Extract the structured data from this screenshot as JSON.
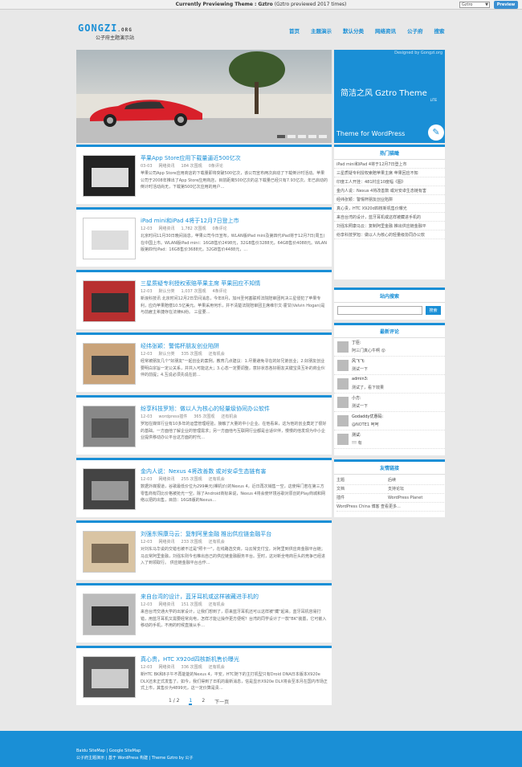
{
  "topbar": {
    "prefix": "Currently Previewing Theme :",
    "theme": "Gztro",
    "times": "(Gztro previewed 2017 times)",
    "select": "Gztro",
    "preview": "Preview"
  },
  "logo": {
    "main": "GONGZI",
    "tld": ".ORG",
    "sub": "公子府主题演示站"
  },
  "nav": [
    "首页",
    "主题演示",
    "默认分类",
    "网络资讯",
    "公子府",
    "搜索"
  ],
  "slider": {
    "credit": "Designed by Gongzi.org",
    "title": "简洁之风 Gztro Theme",
    "lite": "LITE",
    "subtitle": "Theme for WordPress",
    "pen": "✎"
  },
  "posts": [
    {
      "title": "苹果App Store应用下载量逼近500亿次",
      "date": "03-03",
      "cat": "网络资讯",
      "views": "184 次围观",
      "comments": "0条评论",
      "excerpt": "苹果公司App Store应用商店的下载量即将突破500亿次，该公司宣布两次启动了下载倒计时活动。苹果公司于2008年推出了App Store应用商店，目前距离500亿次的总下载量已经只有7.93亿次。年已启动的倒计时活动尚无，下载第500亿次应用的用户…"
    },
    {
      "title": "iPad mini和iPad 4将于12月7日登上市",
      "date": "12-03",
      "cat": "网络资讯",
      "views": "1,782 次围观",
      "comments": "0条评论",
      "excerpt": "北京时间11月30日晚间消息，苹果公司今日宣布，WLAN版iPad mini及第四代iPad将于12月7日(周五)在中国上市。WLAN版iPad mini：16GB售价2498元，32GB售价3288元，64GB售价4088元。WLAN版第四代iPad：16GB售价3688元，32GB售价4488元，…"
    },
    {
      "title": "三星质疑专利授权索赔苹果主席 苹果回应不知情",
      "date": "12-03",
      "cat": "默认分类",
      "views": "1,037 次围观",
      "comments": "4条评论",
      "excerpt": "新浪科技讯 北京时间12月2日早间消息，今年8月，加州圣何塞联邦法院陪审团判决三星侵犯了苹果专利，应向苹果赔偿10.5亿美元。苹果采用何乐，并不清楚法院陪审团主席维尔文·霍甘(Velvin Hogan)是与前雇主希捷存在法律纠纷。        三星要…"
    },
    {
      "title": "经纬张颖：警惕杯朋友创业陷阱",
      "date": "12-03",
      "cat": "默认分类",
      "views": "335 次围观",
      "comments": "还有机会",
      "excerpt": "经常被朋友几个\"好朋友\"一起创业的案例，教育几点建议：1.尽量避免寻在的好兄弟创业；2.好朋友创业要明白宗旨一定公关系，并共入可能这大；3.心态一定要调整，意好状态各好朋友关键宝贵互补的商业伙伴的前提；4.互说必须先说在前…"
    },
    {
      "title": "纷享科技罗旭：做以人为核心的轻量级协同办公软件",
      "date": "12-03",
      "cat": "wordpress插件",
      "views": "365 次围观",
      "comments": "还有机会",
      "excerpt": "罗旭在媒体行业有10多年的运营管理经验，接触了大量的中小企业。在他看来，这为他的创业奠定了很好的基础。一方面他了解企业的管理需求；另一方面他与互联网行业都是合适伙伴，慢慢的他发现为中小企业提供移动办公平台这方面的时代…"
    },
    {
      "title": "金内人说：Nexus 4将改善数 或对安卓生态链有害",
      "date": "12-03",
      "cat": "网络资讯",
      "views": "255 次围观",
      "comments": "还有机会",
      "excerpt": "数据外媒报道，谷歌最低价位为299美元(裸机价)的Nexus 4，近日再次销售一空，这使得门若在第三方零售商有同比价格被抢光一空。除了Android商标来说，Nexus 4将会使环境谷歌对原创的Play商城和网络以把的出售，目前：16GB版的Nexus…"
    },
    {
      "title": "刘强东照康马云：复制阿里金融 推出供应链金融平台",
      "date": "12-03",
      "cat": "网络资讯",
      "views": "233 次围观",
      "comments": "还有机会",
      "excerpt": "对刘东马华说的交错也被不过是\"照卡一\"，在线路选交商，马云常支付宝，对阿里到供应商金融平台链；马云常阿里金融，刘强东则今也推出自己的供应链金融服务平台。至时，这对新全电商巨头的竞争已经进入了到领取行。      供应链金融平台合作…"
    },
    {
      "title": "来自台湾的设计，蓝牙耳机或这样被藏进手机的",
      "date": "12-03",
      "cat": "网络资讯",
      "views": "151 次围观",
      "comments": "还有机会",
      "excerpt": "来自台湾交通大学的出家设计，让我们想到了，原来蓝牙耳机还可以这样被\"藏\"起来。蓝牙耳机容易打错，用蓝牙耳机又需要经常充电，怎样才能让操作更方便呢？台湾的同学设计了一款\"BK\"装置，它可嵌入移动的手机，不用的时候直接从手…"
    },
    {
      "title": "真心贵，HTC X920d四核新机售价曝光",
      "date": "12-03",
      "cat": "网络资讯",
      "views": "336 次围观",
      "comments": "还有机会",
      "excerpt": "新HTC BK和8子午不再能能的Nexus 4，平安，HTC随下的主打机型只有Droid DNA日本版本X920e DLX还未正式发售了。如今，我们得到了日机的最新消息，信是显示X920e DLX将会至本月在国内市场正式上市，其售价为4899元，这一定价算是贵…"
    }
  ],
  "pager": [
    "1 / 2",
    "1",
    "2",
    "下一页"
  ],
  "hot": {
    "title": "热门猫瞰",
    "items": [
      "iPad mini和iPad 4将于12月7日登上市",
      "三星质疑专利授权索赔苹果主席 苹果回应不知",
      "印度工人开挂：481村庄10度幅《图》",
      "金内人说：Nexus 4将改善数 或对安卓生态链有害",
      "经纬张颖：警惕杯朋友创业陷阱",
      "真心贵，HTC X920d四核新机售价曝光",
      "来自台湾的设计，蓝牙耳机或这样被藏进手机的",
      "刘强东照康马云：复制阿里金融 推出供应链金融平",
      "纷享科技罗旭：做以人为核心的轻量级协同办公软"
    ]
  },
  "searchw": {
    "title": "站内搜索",
    "button": "搜索"
  },
  "comments": {
    "title": "最新评论",
    "items": [
      {
        "name": "丁臣:",
        "text": "阿三门真心牛啊 😮"
      },
      {
        "name": "风飞飞:",
        "text": "测试一下"
      },
      {
        "name": "admin3:",
        "text": "测试了，看下效果"
      },
      {
        "name": "小方:",
        "text": "测试一下"
      },
      {
        "name": "Godaddy优惠码:",
        "text": "@NOTE1 呵呵"
      },
      {
        "name": "测试:",
        "text": "!!! 有"
      }
    ]
  },
  "linksw": {
    "title": "友情链接",
    "items": [
      "主题",
      "后续",
      "文档",
      "支持论坛",
      "插件",
      "WordPress Planet",
      "WordPress China 博客 查看更多..."
    ]
  },
  "footer": {
    "line1": "Baidu SiteMap | Google SiteMap",
    "line2": "公子府主题演示 | 基于 WordPress 构建 | Theme Gztro by 公子"
  },
  "colors": {
    "accent": "#1a8fd6",
    "car": "#d8202a"
  }
}
